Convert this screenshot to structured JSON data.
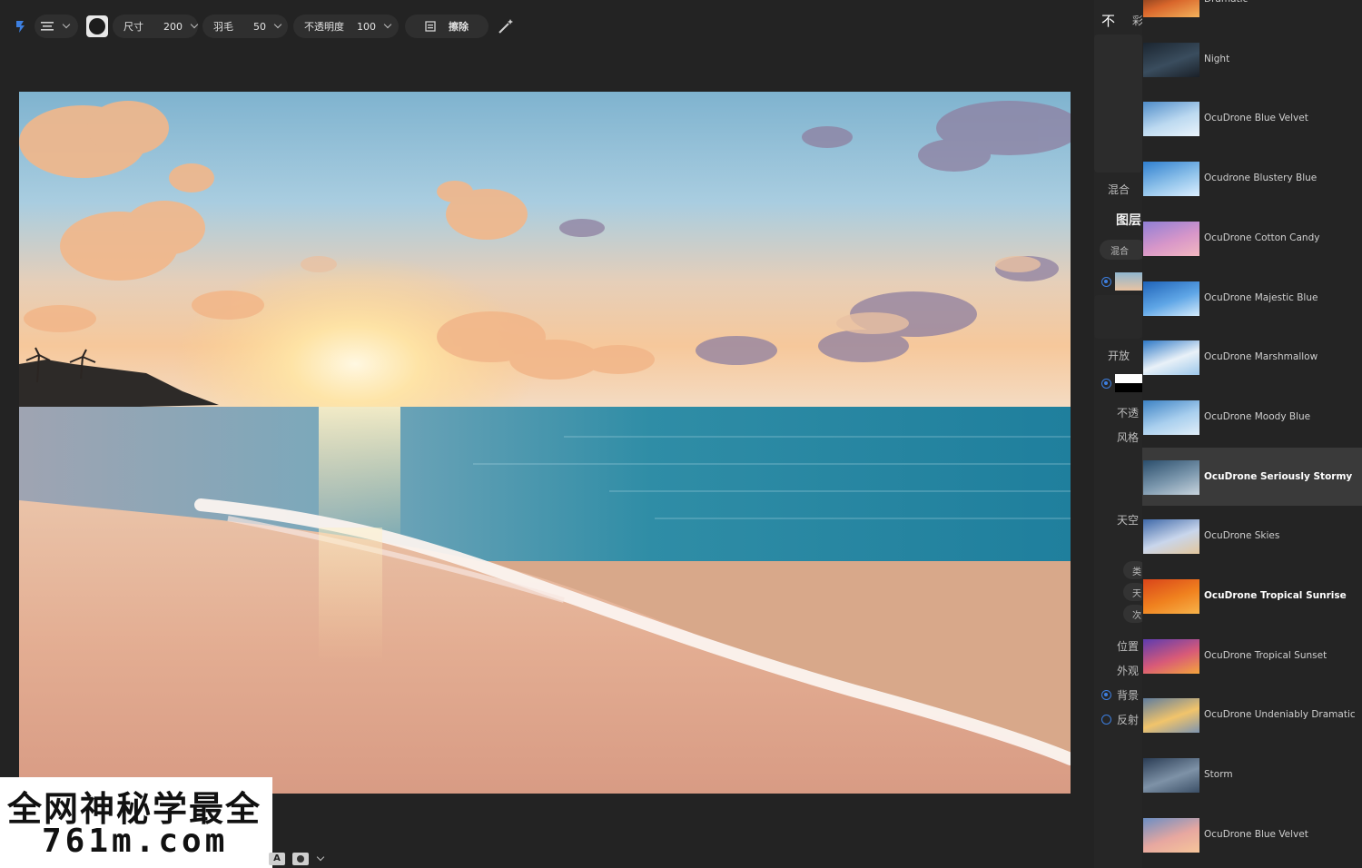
{
  "toolbar": {
    "size_label": "尺寸",
    "size_value": "200",
    "feather_label": "羽毛",
    "feather_value": "50",
    "opacity_label": "不透明度",
    "opacity_value": "100",
    "erase_label": "擦除"
  },
  "side_panel": {
    "tab_glyph_1": "不",
    "tab_glyph_2": "彩",
    "blend_label": "混合",
    "layers_title": "图层",
    "blend_small": "混合",
    "develop_label": "开放",
    "opacity_short": "不透",
    "style_label": "风格",
    "sky_label": "天空",
    "ref_a": "类",
    "ref_b": "天",
    "ref_c": "次",
    "position_label": "位置",
    "appearance_label": "外观",
    "background_label": "背景",
    "reflection_label": "反射"
  },
  "sky_presets": [
    {
      "label": "Dramatic",
      "bold": false,
      "selected": false,
      "c1": "#3b1d14",
      "c2": "#d9662b",
      "c3": "#f3b35c"
    },
    {
      "label": "Night",
      "bold": false,
      "selected": false,
      "c1": "#1b2530",
      "c2": "#3a4d5e",
      "c3": "#1a2028"
    },
    {
      "label": "OcuDrone Blue Velvet",
      "bold": false,
      "selected": false,
      "c1": "#4e8cc9",
      "c2": "#bcd9f0",
      "c3": "#eaf3fb"
    },
    {
      "label": "Ocudrone Blustery Blue",
      "bold": false,
      "selected": false,
      "c1": "#2f7fd0",
      "c2": "#8fc2ea",
      "c3": "#dcefff"
    },
    {
      "label": "OcuDrone Cotton Candy",
      "bold": false,
      "selected": false,
      "c1": "#8f7fd6",
      "c2": "#d796c9",
      "c3": "#f2b7c0"
    },
    {
      "label": "OcuDrone Majestic Blue",
      "bold": false,
      "selected": false,
      "c1": "#1f63b8",
      "c2": "#5fa6e6",
      "c3": "#d4ebfb"
    },
    {
      "label": "OcuDrone Marshmallow",
      "bold": false,
      "selected": false,
      "c1": "#2d78c6",
      "c2": "#e9f1f8",
      "c3": "#9cc7ea"
    },
    {
      "label": "OcuDrone Moody Blue",
      "bold": false,
      "selected": false,
      "c1": "#3c82c4",
      "c2": "#a9cfee",
      "c3": "#e1eef8"
    },
    {
      "label": "OcuDrone Seriously Stormy",
      "bold": true,
      "selected": true,
      "c1": "#2a4d6b",
      "c2": "#7b97ad",
      "c3": "#c8d4dd"
    },
    {
      "label": "OcuDrone Skies",
      "bold": false,
      "selected": false,
      "c1": "#3e68a8",
      "c2": "#c9d6ec",
      "c3": "#e2c69c"
    },
    {
      "label": "OcuDrone Tropical Sunrise",
      "bold": true,
      "selected": false,
      "c1": "#d9441a",
      "c2": "#f0821f",
      "c3": "#f7b34a"
    },
    {
      "label": "OcuDrone Tropical Sunset",
      "bold": false,
      "selected": false,
      "c1": "#5c3bb0",
      "c2": "#d85a78",
      "c3": "#f4a53c"
    },
    {
      "label": "OcuDrone Undeniably Dramatic",
      "bold": false,
      "selected": false,
      "c1": "#5e7c9e",
      "c2": "#f1c46b",
      "c3": "#7d94b0"
    },
    {
      "label": "Storm",
      "bold": false,
      "selected": false,
      "c1": "#2a3c54",
      "c2": "#7e92a7",
      "c3": "#3b4f66"
    },
    {
      "label": "OcuDrone Blue Velvet",
      "bold": false,
      "selected": false,
      "c1": "#6a8ec4",
      "c2": "#e7a7a0",
      "c3": "#f6c59a"
    }
  ],
  "watermark": {
    "line1": "全网神秘学最全",
    "line2": "761m.com"
  },
  "bottom_bar": {
    "auto_label": "A"
  }
}
